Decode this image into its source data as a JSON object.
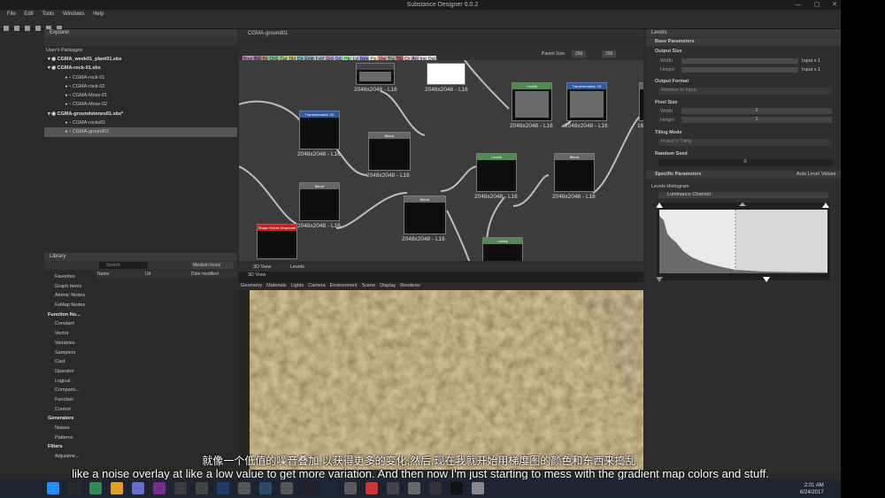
{
  "window": {
    "title": "Substance Designer 6.0.2"
  },
  "menu": [
    "File",
    "Edit",
    "Tools",
    "Windows",
    "Help"
  ],
  "explorer": {
    "title": "Explorer",
    "section": "User's Packages",
    "items": [
      {
        "label": "CGMA_week01_plant01.sbs",
        "level": 0,
        "bold": true
      },
      {
        "label": "CGMA-rock-01.sbs",
        "level": 0,
        "bold": true
      },
      {
        "label": "CGMA-rock-01",
        "level": 1,
        "bold": false
      },
      {
        "label": "CGMA-rock-02",
        "level": 1,
        "bold": false
      },
      {
        "label": "CGMA-Moss-01",
        "level": 1,
        "bold": false
      },
      {
        "label": "CGMA-Moss-02",
        "level": 1,
        "bold": false
      },
      {
        "label": "CGMA-groundstones01.sbs*",
        "level": 0,
        "bold": true
      },
      {
        "label": "CGMA-rocks01",
        "level": 1,
        "bold": false
      },
      {
        "label": "CGMA-ground01",
        "level": 1,
        "bold": false,
        "selected": true
      }
    ]
  },
  "library": {
    "title": "Library",
    "search_placeholder": "Search",
    "view_mode": "Medium Icons",
    "columns": [
      "Name",
      "Url",
      "Date modified"
    ],
    "categories": [
      {
        "label": "Favorites",
        "header": false
      },
      {
        "label": "Graph Items",
        "header": false
      },
      {
        "label": "Atomic Nodes",
        "header": false
      },
      {
        "label": "FxMap Nodes",
        "header": false
      },
      {
        "label": "Function No...",
        "header": true
      },
      {
        "label": "Constant",
        "header": false
      },
      {
        "label": "Vector",
        "header": false
      },
      {
        "label": "Variables",
        "header": false
      },
      {
        "label": "Samplers",
        "header": false
      },
      {
        "label": "Cast",
        "header": false
      },
      {
        "label": "Operator",
        "header": false
      },
      {
        "label": "Logical",
        "header": false
      },
      {
        "label": "Comparis...",
        "header": false
      },
      {
        "label": "Function",
        "header": false
      },
      {
        "label": "Control",
        "header": false
      },
      {
        "label": "Generators",
        "header": true
      },
      {
        "label": "Noises",
        "header": false
      },
      {
        "label": "Patterns",
        "header": false
      },
      {
        "label": "Filters",
        "header": true
      },
      {
        "label": "Adjustme...",
        "header": false
      }
    ]
  },
  "graph": {
    "tab": "CGMA-ground01",
    "parent_size_label": "Parent Size:",
    "parent_size": "256",
    "parent_size2": "256",
    "chips": [
      "Bmp",
      "Bld",
      "Blr",
      "ChS",
      "Cur",
      "Dbl",
      "Dir",
      "Emb",
      "FxM",
      "Grd",
      "GrL",
      "Hbl",
      "Lvl",
      "Nrm",
      "Pix",
      "Shp",
      "Tra",
      "Trb",
      "Clr",
      "Arc",
      "Inp",
      "Out"
    ],
    "nodes": [
      {
        "label": "2048x2048 - L16",
        "title": "Transformation 2D"
      },
      {
        "label": "2048x2048 - L16",
        "title": "Blend"
      },
      {
        "label": "2048x2048 - L16",
        "title": "Blend"
      },
      {
        "label": "2048x2048 - L16",
        "title": "Blend"
      },
      {
        "label": "2048x2048 - L16",
        "title": "Levels"
      },
      {
        "label": "2048x2048 - L16",
        "title": "Levels"
      },
      {
        "label": "2048x2048 - L16",
        "title": "Transformation 2D"
      },
      {
        "label": "2048x2048 - L16",
        "title": "Blend"
      },
      {
        "label": "2048x2048 - L16",
        "title": ""
      },
      {
        "label": "2048x2048 - L16",
        "title": ""
      },
      {
        "label": "",
        "title": "Shape Extrat Grayscale"
      },
      {
        "label": "",
        "title": "Levels"
      },
      {
        "label": "16",
        "title": ""
      },
      {
        "label": "16",
        "title": ""
      }
    ]
  },
  "view3d": {
    "tabs": [
      "3D View",
      "Levels"
    ],
    "title": "3D View",
    "menu": [
      "Geometry",
      "Materials",
      "Lights",
      "Camera",
      "Environment",
      "Scene",
      "Display",
      "Renderer"
    ]
  },
  "levels": {
    "title": "Levels",
    "base_params": "Base Parameters",
    "output_size": "Output Size",
    "width_label": "Width",
    "height_label": "Height",
    "width_value": "Input x 1",
    "height_value": "Input x 1",
    "output_format": "Output Format",
    "output_format_value": "Relative to Input",
    "pixel_size": "Pixel Size",
    "pixel_w": "1",
    "pixel_h": "1",
    "tiling_mode": "Tiling Mode",
    "tiling_value": "H and V Tiling",
    "random_seed": "Random Seed",
    "seed_value": "0",
    "specific_params": "Specific Parameters",
    "auto_level": "Auto Level",
    "values_label": "Values",
    "histogram_label": "Levels Histogram",
    "channel": "Luminance Channel"
  },
  "subtitle": {
    "cn": "就像一个低值的噪音叠加,以获得更多的变化,然后,现在我就开始用梯度图的颜色和东西来捣乱,",
    "en": "like a noise overlay at like a low value to get more variation. And then now I'm just starting to mess with the gradient map colors and stuff."
  },
  "taskbar": {
    "time": "2:01 AM",
    "date": "6/24/2017",
    "icons": [
      "windows-start",
      "explorer",
      "store",
      "chrome",
      "mail",
      "onenote",
      "app",
      "app2",
      "photoshop",
      "app3",
      "lightroom",
      "app4",
      "epic",
      "steam",
      "app5",
      "app6",
      "app7",
      "app8",
      "app9",
      "unreal",
      "app10"
    ]
  }
}
